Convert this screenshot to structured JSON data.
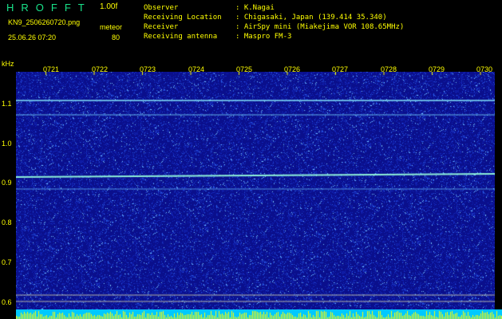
{
  "app": {
    "title": "HROFFT",
    "version": "1.00f",
    "filename": "KN9_2506260720.png",
    "mode": "meteor",
    "timestamp": "25.06.26 07:20",
    "value": "80"
  },
  "station": [
    {
      "label": "Observer",
      "value": ": K.Nagai"
    },
    {
      "label": "Receiving Location",
      "value": ": Chigasaki, Japan (139.414 35.340)"
    },
    {
      "label": "Receiver",
      "value": ": AirSpy mini (Miakejima VOR 108.65MHz)"
    },
    {
      "label": "Receiving antenna",
      "value": ": Maspro FM-3"
    }
  ],
  "axis": {
    "unit": "kHz",
    "y_ticks": [
      "1.1",
      "1.0",
      "0.9",
      "0.8",
      "0.7",
      "0.6"
    ],
    "x_ticks": [
      "0721",
      "0722",
      "0723",
      "0724",
      "0725",
      "0726",
      "0727",
      "0728",
      "0729",
      "0730"
    ]
  },
  "colors": {
    "background": "#000000",
    "plot_bg": "#0a0f8c",
    "text": "#ffff00",
    "title": "#19e38a",
    "signal": "#7fe8ff"
  }
}
